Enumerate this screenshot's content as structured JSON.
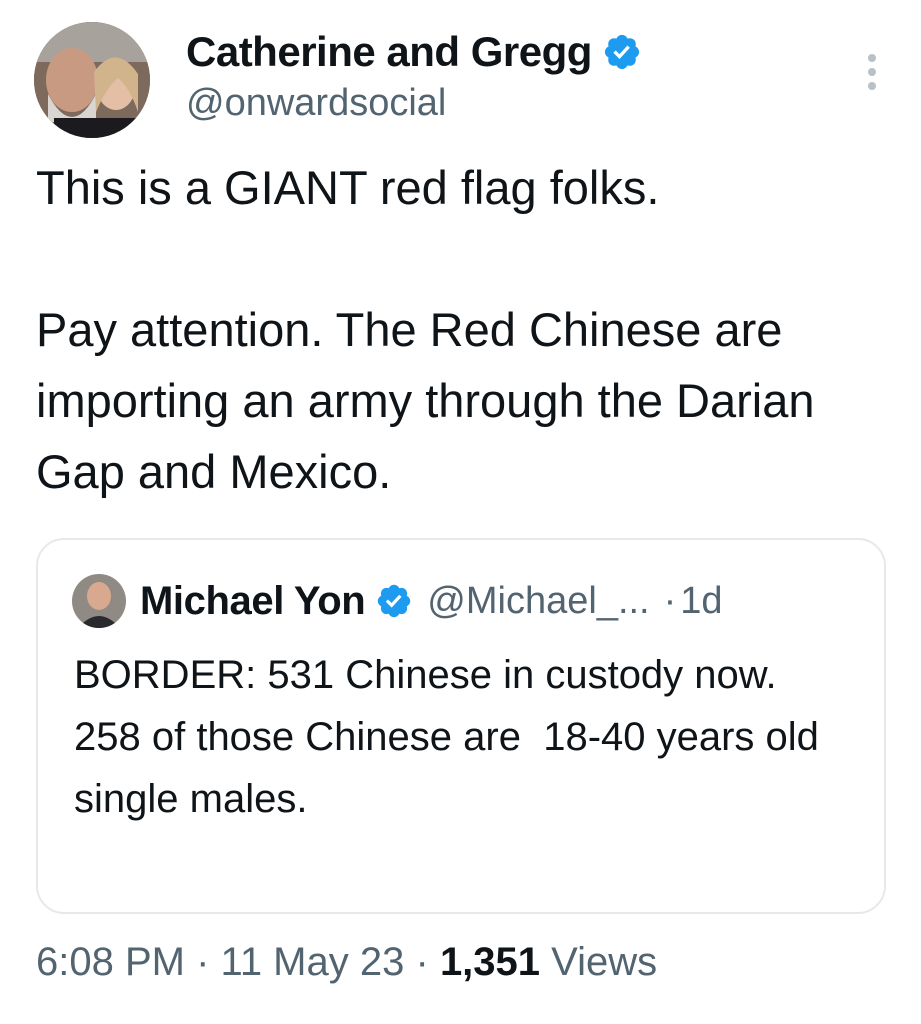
{
  "author": {
    "display_name": "Catherine and Gregg",
    "handle": "@onwardsocial",
    "avatar_icon": "avatar-photo",
    "verified_icon": "verified-badge-icon"
  },
  "tweet": {
    "text": "This is a GIANT red flag folks.\n\nPay attention. The Red Chinese are importing an army through the Darian Gap and Mexico."
  },
  "quote": {
    "display_name": "Michael Yon",
    "handle": "@Michael_...",
    "separator": "·",
    "time": "1d",
    "text": "BORDER: 531 Chinese in custody now.\n258 of those Chinese are  18-40 years old single males."
  },
  "meta": {
    "time": "6:08 PM",
    "date": "11 May 23",
    "separator": "·",
    "views_count": "1,351",
    "views_label": "Views"
  },
  "colors": {
    "text": "#0f1419",
    "secondary": "#536471",
    "verified": "#1d9bf0",
    "border": "#e6e9ec"
  }
}
